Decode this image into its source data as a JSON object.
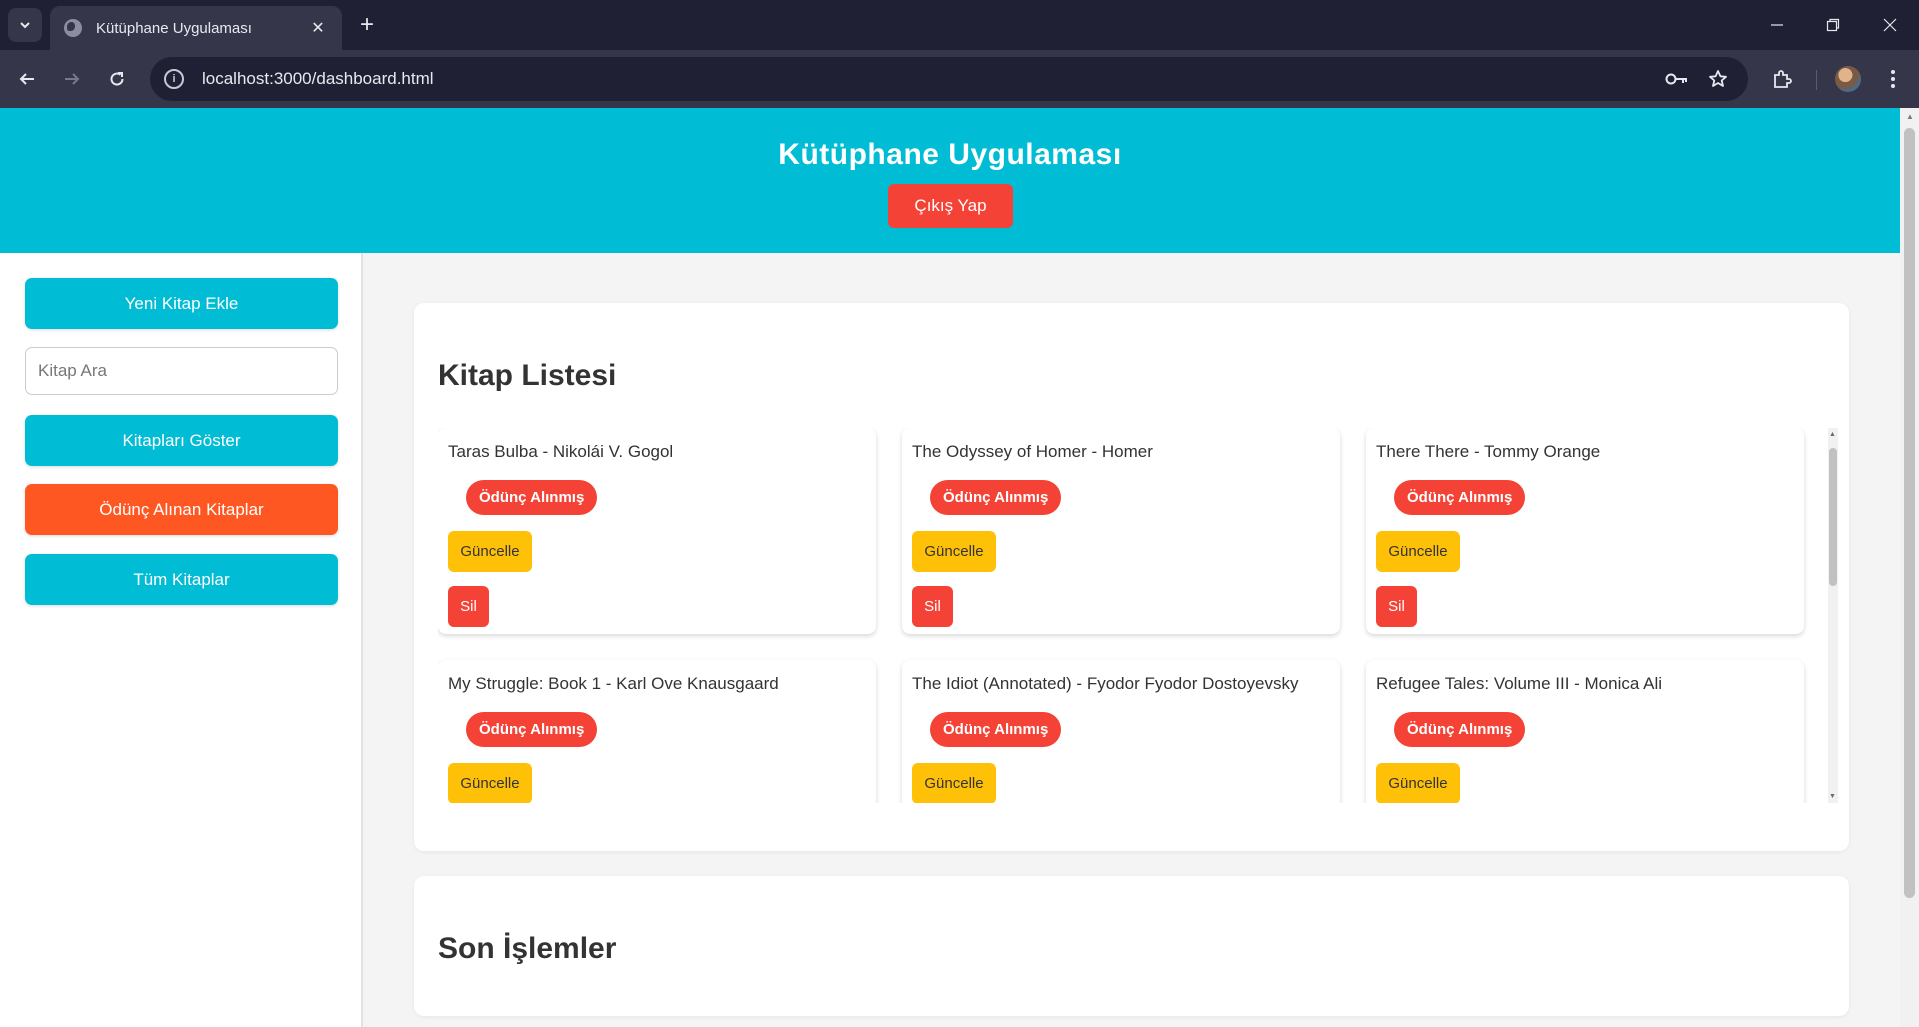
{
  "browser": {
    "tab_title": "Kütüphane Uygulaması",
    "url": "localhost:3000/dashboard.html"
  },
  "header": {
    "title": "Kütüphane Uygulaması",
    "logout_label": "Çıkış Yap"
  },
  "sidebar": {
    "add_book_label": "Yeni Kitap Ekle",
    "search_placeholder": "Kitap Ara",
    "show_books_label": "Kitapları Göster",
    "borrowed_books_label": "Ödünç Alınan Kitaplar",
    "all_books_label": "Tüm Kitaplar"
  },
  "book_list": {
    "title": "Kitap Listesi",
    "status_label": "Ödünç Alınmış",
    "update_label": "Güncelle",
    "delete_label": "Sil",
    "books": [
      {
        "name": "Taras Bulba - Nikolái V. Gogol"
      },
      {
        "name": "The Odyssey of Homer - Homer"
      },
      {
        "name": "There There - Tommy Orange"
      },
      {
        "name": "My Struggle: Book 1 - Karl Ove Knausgaard"
      },
      {
        "name": "The Idiot (Annotated) - Fyodor Fyodor Dostoyevsky"
      },
      {
        "name": "Refugee Tales: Volume III - Monica Ali"
      }
    ]
  },
  "recent_activity": {
    "title": "Son İşlemler"
  },
  "colors": {
    "header": "#00bcd4",
    "danger": "#f44336",
    "warning": "#ffc107",
    "orange": "#ff5722"
  }
}
